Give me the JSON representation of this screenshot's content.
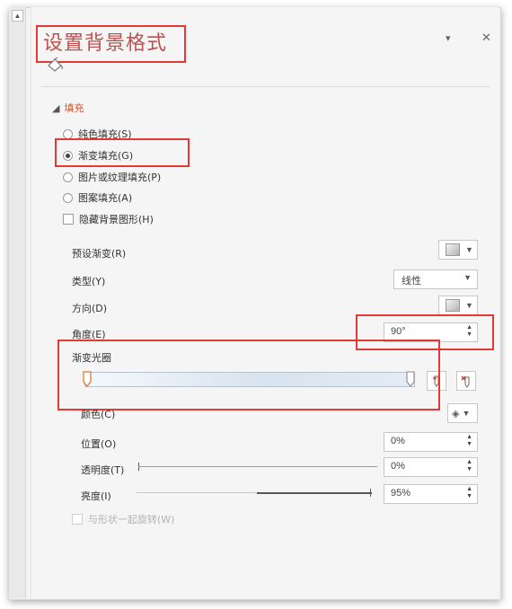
{
  "panel": {
    "title": "设置背景格式",
    "section_fill": "填充",
    "fill_options": [
      {
        "label": "纯色填充(S)",
        "selected": false
      },
      {
        "label": "渐变填充(G)",
        "selected": true
      },
      {
        "label": "图片或纹理填充(P)",
        "selected": false
      },
      {
        "label": "图案填充(A)",
        "selected": false
      }
    ],
    "hide_bg_label": "隐藏背景图形(H)",
    "preset_label": "预设渐变(R)",
    "type_label": "类型(Y)",
    "type_value": "线性",
    "direction_label": "方向(D)",
    "angle_label": "角度(E)",
    "angle_value": "90°",
    "gradient_stops_label": "渐变光圈",
    "color_label": "颜色(C)",
    "position_label": "位置(O)",
    "position_value": "0%",
    "transparency_label": "透明度(T)",
    "transparency_value": "0%",
    "brightness_label": "亮度(I)",
    "brightness_value": "95%",
    "rotate_label": "与形状一起旋转(W)",
    "pin_glyph": "▾",
    "close_glyph": "✕"
  },
  "colors": {
    "accent_title": "#c0504d",
    "annotation_red": "#e53935",
    "section": "#d0542e"
  }
}
